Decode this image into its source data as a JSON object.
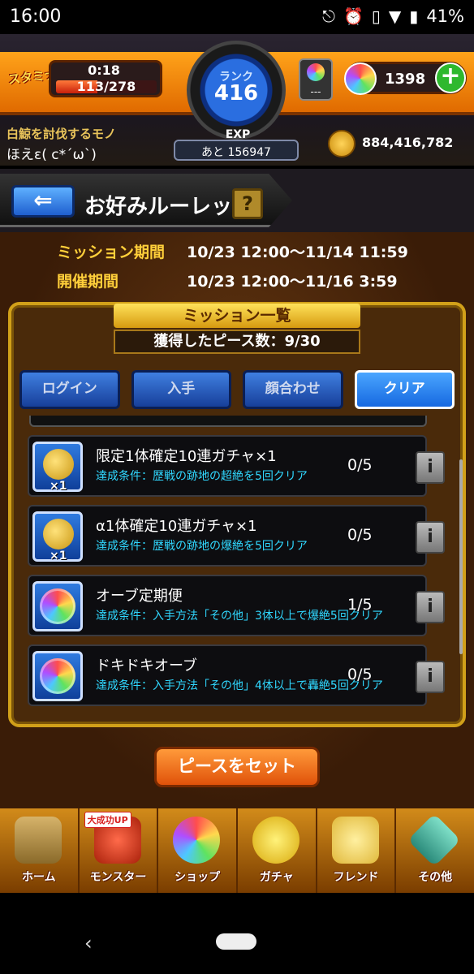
{
  "status": {
    "time": "16:00",
    "battery": "41%"
  },
  "header": {
    "stamina_label": "スタミナ",
    "stamina_timer": "0:18",
    "stamina_value": "113/278",
    "stamina_fraction": 0.41,
    "rank_label": "ランク",
    "rank": "416",
    "exp_label": "EXP",
    "exp_remaining": "あと 156947",
    "orb_slot": "---",
    "gems": "1398",
    "player_title": "白鯨を討伐するモノ",
    "player_name": "ほえε( c*´ω`)",
    "coins": "884,416,782"
  },
  "titlebar": {
    "back": "⇐",
    "title": "お好みルーレット",
    "help": "?"
  },
  "periods": [
    {
      "label": "ミッション期間",
      "value": "10/23 12:00～11/14 11:59"
    },
    {
      "label": "開催期間",
      "value": "10/23 12:00～11/16  3:59"
    }
  ],
  "panel": {
    "heading": "ミッション一覧",
    "pieces": "獲得したピース数：9/30"
  },
  "tabs": [
    {
      "label": "ログイン"
    },
    {
      "label": "入手"
    },
    {
      "label": "顔合わせ"
    },
    {
      "label": "クリア"
    }
  ],
  "missions": [
    {
      "name": "限定1体確定10連ガチャ×1",
      "cond": "達成条件：歴戦の跡地の超絶を5回クリア",
      "progress": "0/5",
      "qty": "×1",
      "icon": "dragon-icon"
    },
    {
      "name": "α1体確定10連ガチャ×1",
      "cond": "達成条件：歴戦の跡地の爆絶を5回クリア",
      "progress": "0/5",
      "qty": "×1",
      "icon": "dragon-icon"
    },
    {
      "name": "オーブ定期便",
      "cond": "達成条件：入手方法「その他」3体以上で爆絶5回クリア",
      "progress": "1/5",
      "qty": "",
      "icon": "orb-icon"
    },
    {
      "name": "ドキドキオーブ",
      "cond": "達成条件：入手方法「その他」4体以上で轟絶5回クリア",
      "progress": "0/5",
      "qty": "",
      "icon": "orb-icon"
    }
  ],
  "set_button": "ピースをセット",
  "nav": [
    {
      "label": "ホーム",
      "badge": ""
    },
    {
      "label": "モンスター",
      "badge": "大成功UP"
    },
    {
      "label": "ショップ",
      "badge": ""
    },
    {
      "label": "ガチャ",
      "badge": ""
    },
    {
      "label": "フレンド",
      "badge": ""
    },
    {
      "label": "その他",
      "badge": ""
    }
  ],
  "colors": {
    "accent": "#ffcf3a",
    "condition": "#30d8ff",
    "tab": "#1668e0"
  }
}
